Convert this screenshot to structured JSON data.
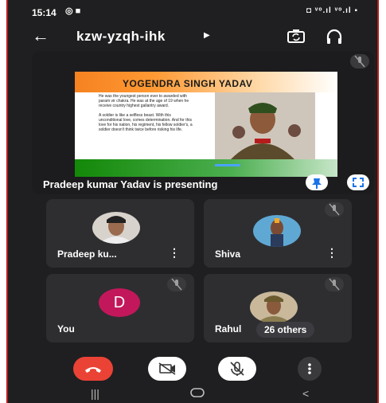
{
  "status_bar": {
    "time": "15:14",
    "icons": "◎ ■",
    "right": "◘ ᵛᵒ.ıl ᵛᵒ.ıl ▪"
  },
  "meeting": {
    "code": "kzw-yzqh-ihk"
  },
  "presentation": {
    "slide_title": "YOGENDRA SINGH YADAV",
    "slide_text_1": "He was the youngest person ever to awarded with param vir chakra. He was at the age of 19 when he receive country highest gallantry award.",
    "slide_text_2": "A soldier is like a selfless beast. With this unconditional love, comes determination. And for this love for his nation, his regiment, his fellow soldier's, a soldier doesn't think twice before risking his life.",
    "presenting_text": "Pradeep kumar Yadav is presenting"
  },
  "participants": [
    {
      "name": "Pradeep ku...",
      "avatar": "photo"
    },
    {
      "name": "Shiva",
      "avatar": "photo"
    },
    {
      "name": "You",
      "avatar_letter": "D",
      "avatar_color": "#c2185b"
    },
    {
      "name": "Rahul",
      "avatar": "photo"
    }
  ],
  "others_label": "26 others",
  "controls": {
    "end_call_icon": "phone-hangup",
    "camera_icon": "camera-off",
    "mic_icon": "mic-off",
    "more_icon": "more-vertical"
  },
  "colors": {
    "end_call": "#ea4335",
    "background": "#1f1f21",
    "tile": "#2e2e31"
  }
}
